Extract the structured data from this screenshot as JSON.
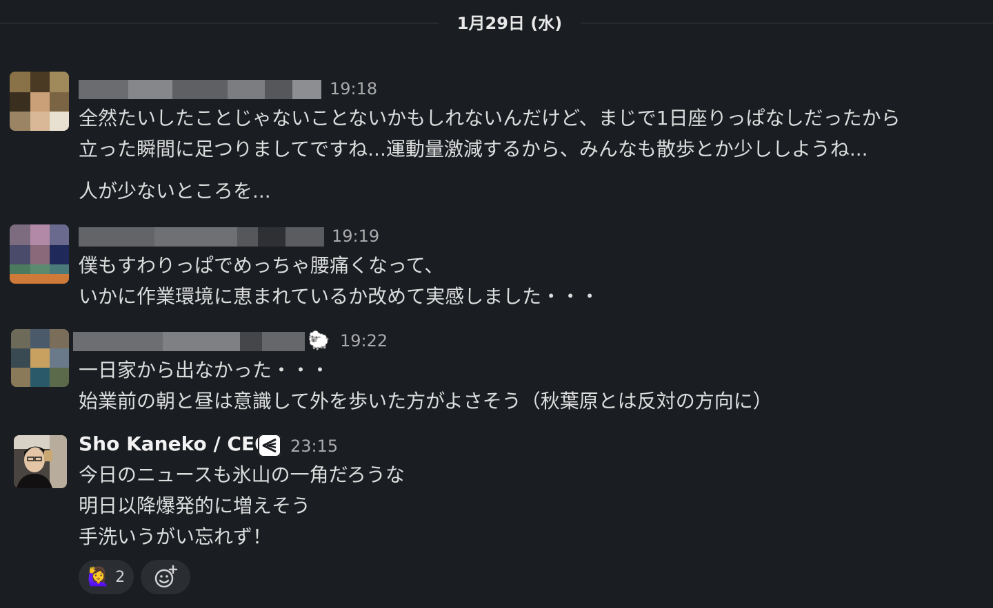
{
  "date_divider": "1月29日 (水)",
  "messages": [
    {
      "time": "19:18",
      "lines": [
        "全然たいしたことじゃないことないかもしれないんだけど、まじで1日座りっぱなしだったから",
        "立った瞬間に足つりましてですね...運動量激減するから、みんなも散歩とか少ししようね...",
        "人が少ないところを..."
      ]
    },
    {
      "time": "19:19",
      "lines": [
        "僕もすわりっぱでめっちゃ腰痛くなって、",
        "いかに作業環境に恵まれているか改めて実感しました・・・"
      ]
    },
    {
      "time": "19:22",
      "status_emoji": "🐑",
      "lines": [
        "一日家から出なかった・・・",
        "始業前の朝と昼は意識して外を歩いた方がよさそう（秋葉原とは反対の方向に）"
      ]
    },
    {
      "sender": "Sho Kaneko / CEO",
      "time": "23:15",
      "lines": [
        "今日のニュースも氷山の一角だろうな",
        "明日以降爆発的に増えそう",
        "手洗いうがい忘れず！"
      ],
      "reactions": [
        {
          "emoji": "🙋‍♀️",
          "count": "2"
        }
      ]
    }
  ],
  "colors": {
    "background": "#1a1d21",
    "text": "#dcdddd",
    "muted": "#ababad",
    "reaction_bg": "#2a2d31"
  }
}
